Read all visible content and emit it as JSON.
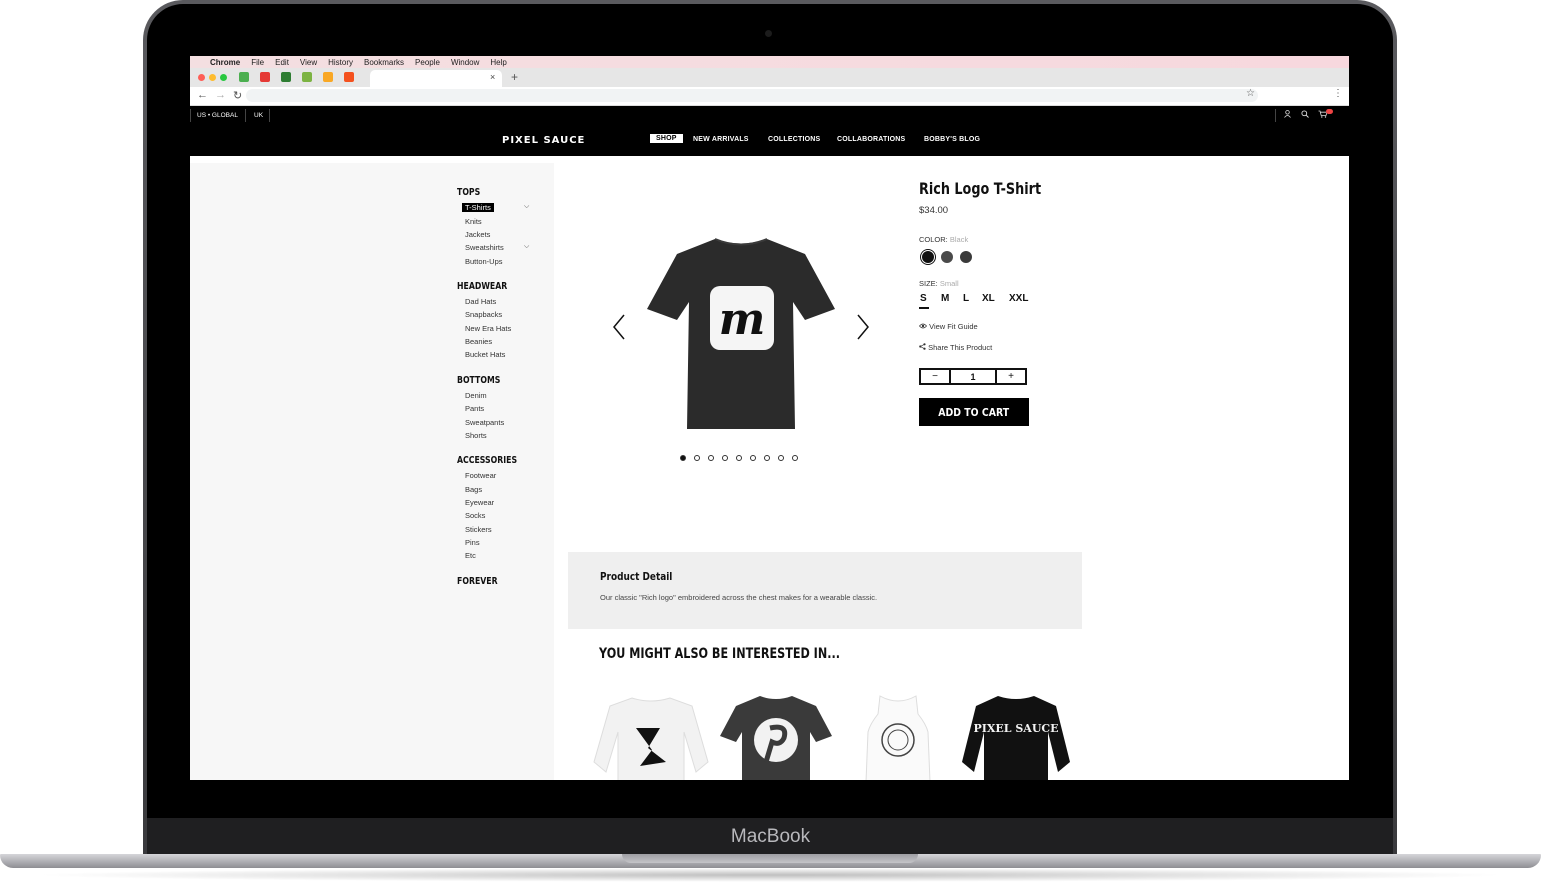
{
  "device_label": "MacBook",
  "os_menubar": {
    "app": "Chrome",
    "items": [
      "File",
      "Edit",
      "View",
      "History",
      "Bookmarks",
      "People",
      "Window",
      "Help"
    ]
  },
  "browser": {
    "close_tab": "×",
    "new_tab": "+",
    "back": "←",
    "forward": "→",
    "reload": "↻",
    "bookmark_star": "☆",
    "menu": "⋮"
  },
  "site_topbar": {
    "regions": [
      "US • GLOBAL",
      "UK"
    ]
  },
  "site_nav": {
    "logo": "PIXEL SAUCE",
    "links": [
      "SHOP",
      "NEW ARRIVALS",
      "COLLECTIONS",
      "COLLABORATIONS",
      "BOBBY'S BLOG"
    ],
    "active": "SHOP"
  },
  "sidebar": {
    "tops": {
      "title": "TOPS",
      "items": [
        "T-Shirts",
        "Knits",
        "Jackets",
        "Sweatshirts",
        "Button-Ups"
      ]
    },
    "headwear": {
      "title": "HEADWEAR",
      "items": [
        "Dad Hats",
        "Snapbacks",
        "New Era Hats",
        "Beanies",
        "Bucket Hats"
      ]
    },
    "bottoms": {
      "title": "BOTTOMS",
      "items": [
        "Denim",
        "Pants",
        "Sweatpants",
        "Shorts"
      ]
    },
    "accessories": {
      "title": "ACCESSORIES",
      "items": [
        "Footwear",
        "Bags",
        "Eyewear",
        "Socks",
        "Stickers",
        "Pins",
        "Etc"
      ]
    },
    "forever": {
      "title": "FOREVER"
    }
  },
  "product": {
    "title": "Rich Logo T-Shirt",
    "price": "$34.00",
    "color_label": "COLOR:",
    "color_value": "Black",
    "colors": [
      "#111111",
      "#4a4a4a",
      "#3a3a3a"
    ],
    "size_label": "SIZE:",
    "size_value": "Small",
    "sizes": [
      "S",
      "M",
      "L",
      "XL",
      "XXL"
    ],
    "fit_guide": "View Fit Guide",
    "share": "Share This Product",
    "quantity": "1",
    "qty_minus": "−",
    "qty_plus": "+",
    "add_to_cart": "ADD TO CART",
    "image_logo_letter": "m",
    "gallery_count": 9,
    "gallery_active": 1
  },
  "detail": {
    "title": "Product Detail",
    "text": "Our classic \"Rich logo\" embroidered across the chest makes for a wearable classic."
  },
  "recommendations": {
    "title": "YOU MIGHT ALSO BE INTERESTED IN...",
    "item4_print": "PIXEL SAUCE"
  }
}
